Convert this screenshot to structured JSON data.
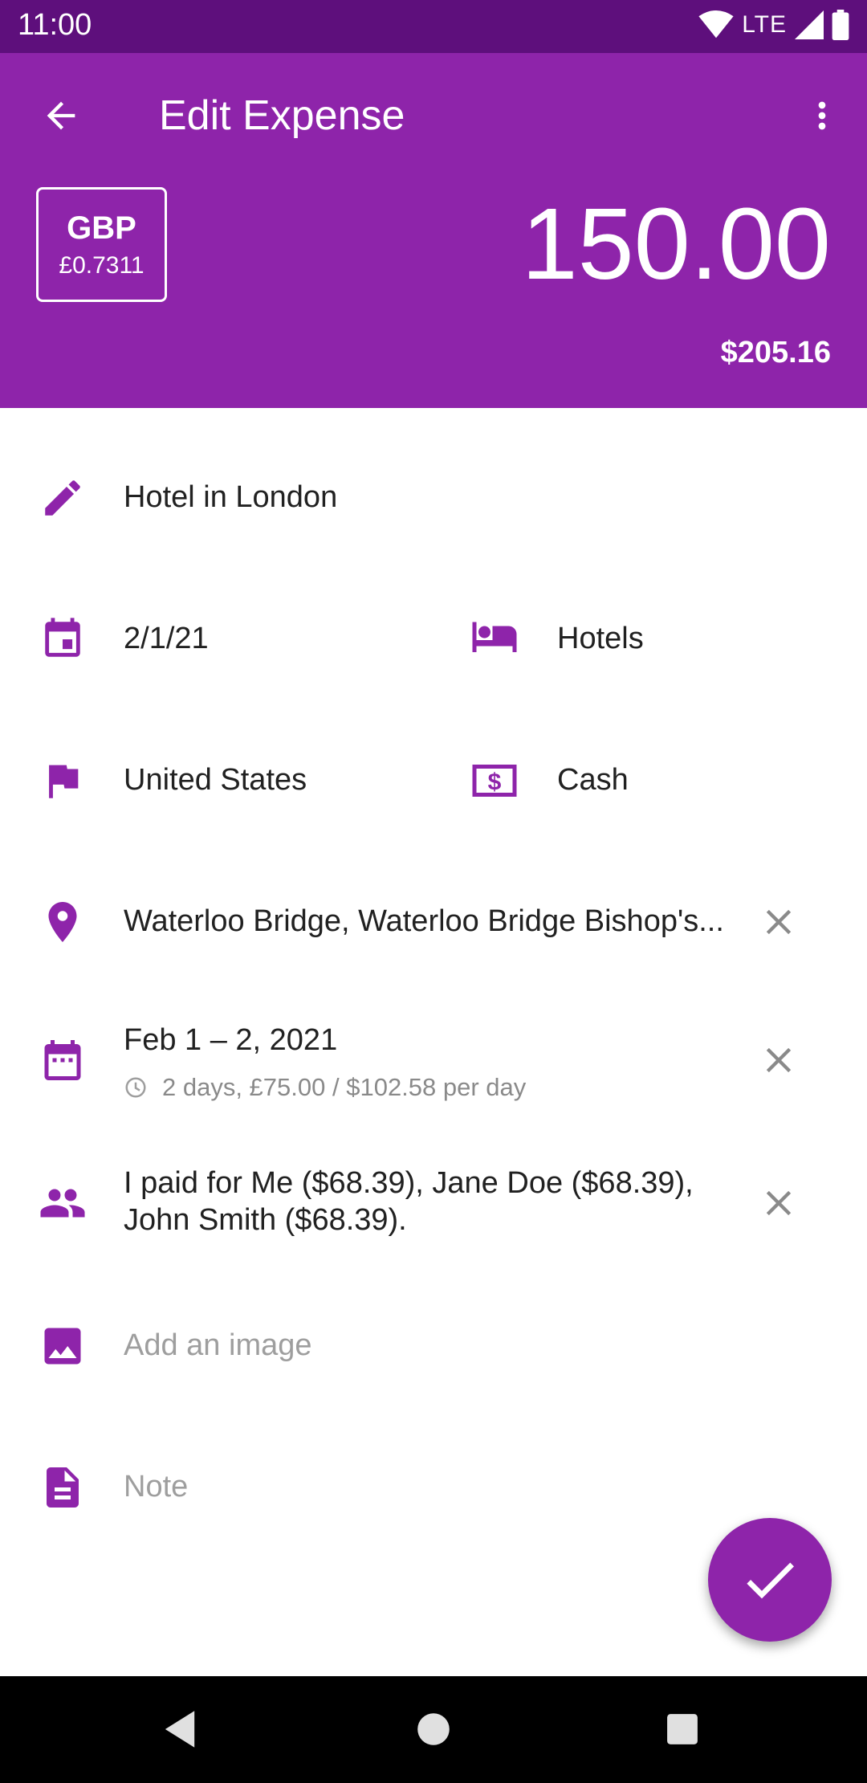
{
  "status_bar": {
    "time": "11:00",
    "network": "LTE"
  },
  "header": {
    "title": "Edit Expense",
    "currency_code": "GBP",
    "exchange_rate": "£0.7311",
    "amount": "150.00",
    "converted_amount": "$205.16"
  },
  "fields": {
    "description": "Hotel in London",
    "date": "2/1/21",
    "category": "Hotels",
    "country": "United States",
    "payment_method": "Cash",
    "location": "Waterloo Bridge, Waterloo Bridge Bishop's...",
    "date_range": "Feb 1 – 2, 2021",
    "date_range_detail": "2 days, £75.00 / $102.58 per day",
    "split_line1": "I paid for Me ($68.39), Jane Doe ($68.39),",
    "split_line2": "John Smith ($68.39).",
    "image_placeholder": "Add an image",
    "note_placeholder": "Note"
  },
  "icons": {
    "back": "arrow-back-icon",
    "menu": "more-vert-icon",
    "description": "pencil-icon",
    "date": "calendar-icon",
    "category": "hotel-bed-icon",
    "country": "flag-icon",
    "payment": "cash-icon",
    "location": "location-pin-icon",
    "date_range": "date-range-icon",
    "split": "people-icon",
    "image": "image-icon",
    "note": "document-icon",
    "confirm": "check-icon"
  },
  "colors": {
    "primary": "#8e24aa",
    "status_bar": "#5e0f7c",
    "icon": "#8e24aa",
    "hint": "#9e9e9e"
  }
}
